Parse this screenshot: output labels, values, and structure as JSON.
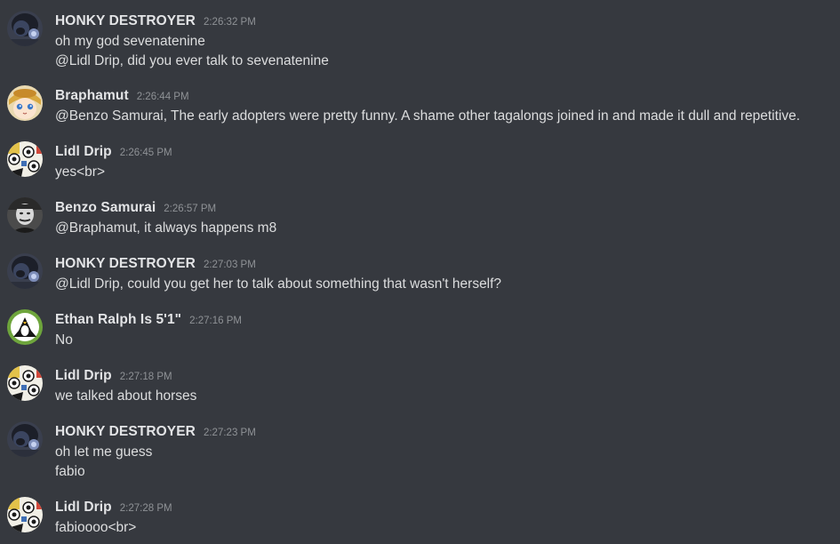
{
  "messages": [
    {
      "username": "HONKY DESTROYER",
      "timestamp": "2:26:32 PM",
      "avatar": "gorilla-avatar",
      "lines": [
        "oh my god sevenatenine",
        "@Lidl Drip, did you ever talk to sevenatenine"
      ]
    },
    {
      "username": "Braphamut",
      "timestamp": "2:26:44 PM",
      "avatar": "anime-girl-avatar",
      "lines": [
        "@Benzo Samurai, The early adopters were pretty funny. A shame other tagalongs joined in and made it dull and repetitive."
      ]
    },
    {
      "username": "Lidl Drip",
      "timestamp": "2:26:45 PM",
      "avatar": "cartoon-collage-avatar",
      "lines": [
        "yes<br>"
      ]
    },
    {
      "username": "Benzo Samurai",
      "timestamp": "2:26:57 PM",
      "avatar": "grayscale-portrait-avatar",
      "lines": [
        "@Braphamut, it always happens m8"
      ]
    },
    {
      "username": "HONKY DESTROYER",
      "timestamp": "2:27:03 PM",
      "avatar": "gorilla-avatar",
      "lines": [
        "@Lidl Drip, could you get her to talk about something that wasn't herself?"
      ]
    },
    {
      "username": "Ethan Ralph Is 5'1\"",
      "timestamp": "2:27:16 PM",
      "avatar": "penguin-avatar",
      "lines": [
        "No"
      ]
    },
    {
      "username": "Lidl Drip",
      "timestamp": "2:27:18 PM",
      "avatar": "cartoon-collage-avatar",
      "lines": [
        "we talked about horses"
      ]
    },
    {
      "username": "HONKY DESTROYER",
      "timestamp": "2:27:23 PM",
      "avatar": "gorilla-avatar",
      "lines": [
        "oh let me guess",
        "fabio"
      ]
    },
    {
      "username": "Lidl Drip",
      "timestamp": "2:27:28 PM",
      "avatar": "cartoon-collage-avatar",
      "lines": [
        "fabioooo<br>"
      ]
    }
  ],
  "colors": {
    "background": "#36393f",
    "username": "#e3e4e6",
    "message_text": "#dcddde",
    "timestamp": "#8f9296"
  }
}
